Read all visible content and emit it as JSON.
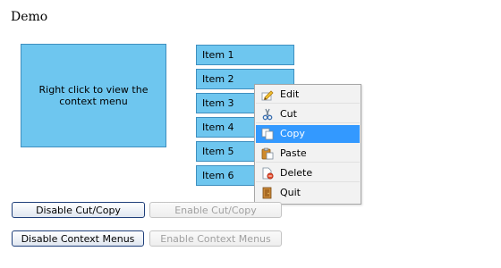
{
  "page": {
    "title": "Demo"
  },
  "context_area": {
    "text": "Right click to view the context menu"
  },
  "list": {
    "items": [
      "Item 1",
      "Item 2",
      "Item 3",
      "Item 4",
      "Item 5",
      "Item 6"
    ]
  },
  "context_menu": {
    "items": [
      {
        "label": "Edit",
        "icon": "pencil-icon"
      },
      {
        "label": "Cut",
        "icon": "scissors-icon"
      },
      {
        "label": "Copy",
        "icon": "copy-icon",
        "selected": true
      },
      {
        "label": "Paste",
        "icon": "paste-icon"
      },
      {
        "label": "Delete",
        "icon": "delete-icon"
      },
      {
        "label": "Quit",
        "icon": "quit-icon"
      }
    ],
    "highlight_color": "#3399ff"
  },
  "buttons": {
    "disable_cut_copy": "Disable Cut/Copy",
    "enable_cut_copy": "Enable Cut/Copy",
    "disable_context_menus": "Disable Context Menus",
    "enable_context_menus": "Enable Context Menus"
  },
  "colors": {
    "item_background": "#6ec6ef",
    "item_border": "#3f8fbf"
  }
}
